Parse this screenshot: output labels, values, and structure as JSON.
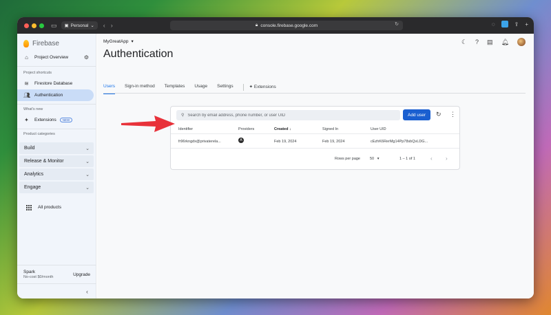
{
  "browser": {
    "profile": "Personal",
    "url": "console.firebase.google.com"
  },
  "sidebar": {
    "brand": "Firebase",
    "project_overview": "Project Overview",
    "shortcuts_title": "Project shortcuts",
    "shortcuts": [
      {
        "label": "Firestore Database",
        "icon": "firestore-icon"
      },
      {
        "label": "Authentication",
        "icon": "people-icon"
      }
    ],
    "whats_new_title": "What's new",
    "extensions_label": "Extensions",
    "new_badge": "NEW",
    "categories_title": "Product categories",
    "categories": [
      "Build",
      "Release & Monitor",
      "Analytics",
      "Engage"
    ],
    "all_products": "All products",
    "plan_name": "Spark",
    "plan_sub": "No-cost $0/month",
    "upgrade": "Upgrade"
  },
  "header": {
    "project": "MyGreatApp",
    "title": "Authentication"
  },
  "tabs": [
    "Users",
    "Sign-in method",
    "Templates",
    "Usage",
    "Settings",
    "Extensions"
  ],
  "users_table": {
    "search_placeholder": "Search by email address, phone number, or user UID",
    "add_user": "Add user",
    "columns": [
      "Identifier",
      "Providers",
      "Created",
      "Signed In",
      "User UID"
    ],
    "rows": [
      {
        "identifier": "fr96rkngdx@privaterela...",
        "provider": "A",
        "created": "Feb 19, 2024",
        "signed_in": "Feb 19, 2024",
        "uid": "cEzhK6RerMg14Pp78sbQvLDG..."
      }
    ],
    "rows_per_page_label": "Rows per page",
    "rows_per_page": "50",
    "range": "1 – 1 of 1"
  },
  "colors": {
    "accent": "#1a73e8",
    "button": "#1a5fd0",
    "annotation_arrow": "#e8323a"
  }
}
